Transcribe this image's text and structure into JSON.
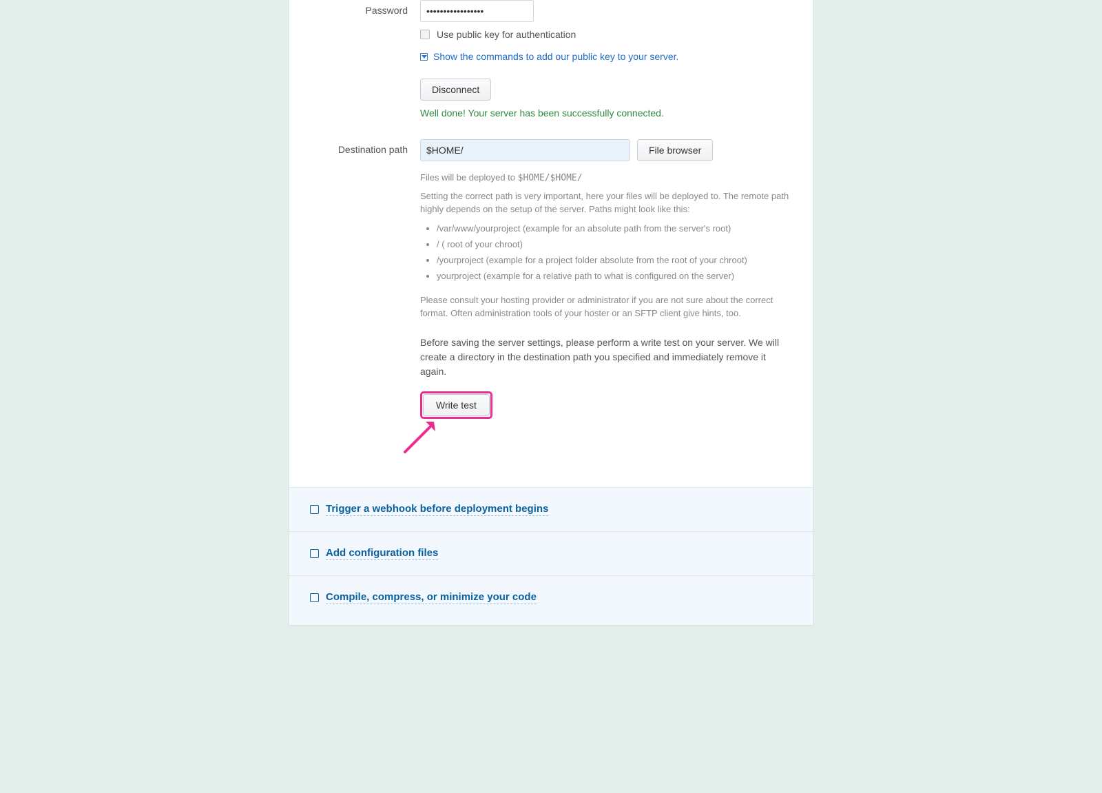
{
  "form": {
    "password_label": "Password",
    "password_value": "•••••••••••••••••",
    "pubkey_checkbox_label": "Use public key for authentication",
    "show_commands_link": "Show the commands to add our public key to your server.",
    "disconnect_label": "Disconnect",
    "success_message": "Well done! Your server has been successfully connected.",
    "dest_label": "Destination path",
    "dest_value": "$HOME/",
    "file_browser_label": "File browser",
    "deploy_help_prefix": "Files will be deployed to ",
    "deploy_help_mono": "$HOME/$HOME/",
    "path_help_1": "Setting the correct path is very important, here your files will be deployed to. The remote path highly depends on the setup of the server. Paths might look like this:",
    "examples": [
      "/var/www/yourproject (example for an absolute path from the server's root)",
      "/ ( root of your chroot)",
      "/yourproject (example for a project folder absolute from the root of your chroot)",
      "yourproject (example for a relative path to what is configured on the server)"
    ],
    "path_help_2": "Please consult your hosting provider or administrator if you are not sure about the correct format. Often administration tools of your hoster or an SFTP client give hints, too.",
    "write_test_instruction": "Before saving the server settings, please perform a write test on your server. We will create a directory in the destination path you specified and immediately remove it again.",
    "write_test_label": "Write test"
  },
  "accordion": {
    "webhook": "Trigger a webhook before deployment begins",
    "config": "Add configuration files",
    "compile": "Compile, compress, or minimize your code"
  }
}
